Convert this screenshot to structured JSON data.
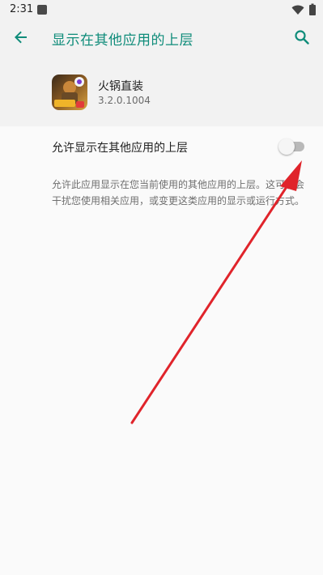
{
  "status_bar": {
    "time": "2:31",
    "icons": [
      "notification-icon",
      "wifi-icon",
      "battery-icon"
    ]
  },
  "app_bar": {
    "title": "显示在其他应用的上层",
    "back_icon": "arrow-back-icon",
    "search_icon": "search-icon"
  },
  "app": {
    "name": "火锅直装",
    "version": "3.2.0.1004"
  },
  "setting": {
    "label": "允许显示在其他应用的上层",
    "enabled": false
  },
  "description": "允许此应用显示在您当前使用的其他应用的上层。这可能会干扰您使用相关应用，或变更这类应用的显示或运行方式。",
  "colors": {
    "accent": "#0f8c7a",
    "background": "#fafafa",
    "header_bg": "#f2f2f2",
    "annotation": "#e0242b"
  }
}
